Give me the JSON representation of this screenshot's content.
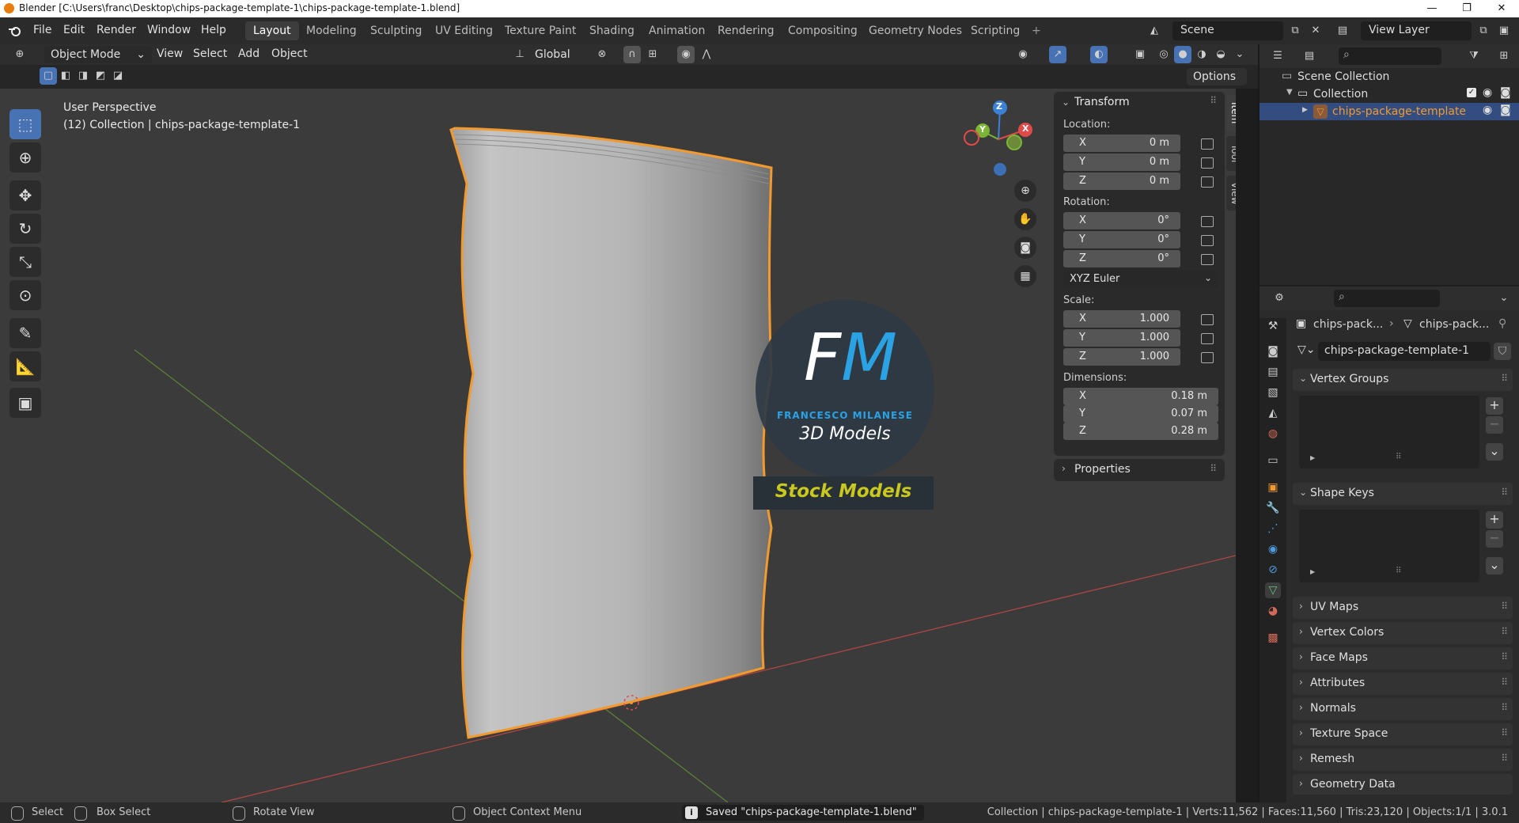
{
  "window": {
    "title": "Blender [C:\\Users\\franc\\Desktop\\chips-package-template-1\\chips-package-template-1.blend]",
    "controls": [
      "—",
      "❐",
      "✕"
    ]
  },
  "menubar": {
    "menus": [
      "File",
      "Edit",
      "Render",
      "Window",
      "Help"
    ],
    "workspaces": [
      "Layout",
      "Modeling",
      "Sculpting",
      "UV Editing",
      "Texture Paint",
      "Shading",
      "Animation",
      "Rendering",
      "Compositing",
      "Geometry Nodes",
      "Scripting"
    ],
    "add_workspace": "+",
    "scene": "Scene",
    "view_layer": "View Layer"
  },
  "viewport_header": {
    "mode": "Object Mode",
    "menus": [
      "View",
      "Select",
      "Add",
      "Object"
    ],
    "orientation": "Global",
    "options": "Options"
  },
  "viewport": {
    "perspective": "User Perspective",
    "collection_info": "(12) Collection | chips-package-template-1",
    "gizmo_axes": [
      "Z",
      "Y",
      "X"
    ],
    "colors": {
      "x": "#e24a4a",
      "y": "#7ab534",
      "z": "#3b82d6",
      "selection": "#f29a2e",
      "background": "#3b3b3b"
    }
  },
  "watermark": {
    "letters_f": "F",
    "letters_m": "M",
    "name": "FRANCESCO MILANESE",
    "subtitle": "3D Models",
    "banner": "Stock Models"
  },
  "npanel": {
    "header": "Transform",
    "location_label": "Location:",
    "location": [
      {
        "axis": "X",
        "value": "0 m"
      },
      {
        "axis": "Y",
        "value": "0 m"
      },
      {
        "axis": "Z",
        "value": "0 m"
      }
    ],
    "rotation_label": "Rotation:",
    "rotation": [
      {
        "axis": "X",
        "value": "0°"
      },
      {
        "axis": "Y",
        "value": "0°"
      },
      {
        "axis": "Z",
        "value": "0°"
      }
    ],
    "rotation_mode": "XYZ Euler",
    "scale_label": "Scale:",
    "scale": [
      {
        "axis": "X",
        "value": "1.000"
      },
      {
        "axis": "Y",
        "value": "1.000"
      },
      {
        "axis": "Z",
        "value": "1.000"
      }
    ],
    "dimensions_label": "Dimensions:",
    "dimensions": [
      {
        "axis": "X",
        "value": "0.18 m"
      },
      {
        "axis": "Y",
        "value": "0.07 m"
      },
      {
        "axis": "Z",
        "value": "0.28 m"
      }
    ],
    "properties": "Properties",
    "tabs": [
      "Item",
      "Tool",
      "View"
    ]
  },
  "outliner": {
    "scene_collection": "Scene Collection",
    "collection": "Collection",
    "object": "chips-package-template"
  },
  "properties": {
    "breadcrumb_object": "chips-pack...",
    "breadcrumb_mesh": "chips-pack...",
    "mesh_name": "chips-package-template-1",
    "sections": [
      {
        "label": "Vertex Groups",
        "open": true
      },
      {
        "label": "Shape Keys",
        "open": true
      },
      {
        "label": "UV Maps",
        "open": false
      },
      {
        "label": "Vertex Colors",
        "open": false
      },
      {
        "label": "Face Maps",
        "open": false
      },
      {
        "label": "Attributes",
        "open": false
      },
      {
        "label": "Normals",
        "open": false
      },
      {
        "label": "Texture Space",
        "open": false
      },
      {
        "label": "Remesh",
        "open": false
      },
      {
        "label": "Geometry Data",
        "open": false
      }
    ]
  },
  "statusbar": {
    "select": "Select",
    "box_select": "Box Select",
    "rotate_view": "Rotate View",
    "context_menu": "Object Context Menu",
    "message": "Saved \"chips-package-template-1.blend\"",
    "stats": "Collection | chips-package-template-1 | Verts:11,562 | Faces:11,560 | Tris:23,120 | Objects:1/1 | 3.0.1"
  }
}
